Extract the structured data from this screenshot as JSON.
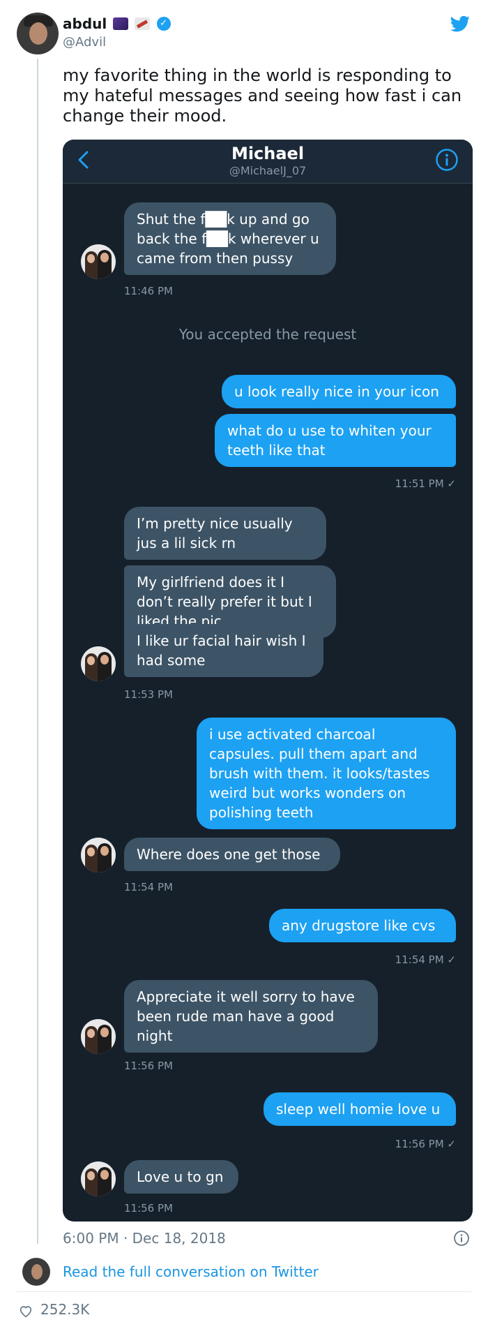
{
  "tweet": {
    "author_name": "abdul",
    "author_handle": "@Advil",
    "text": "my favorite thing in the world is responding to my hateful messages and seeing how fast i can change their mood.",
    "timestamp": "6:00 PM · Dec 18, 2018",
    "read_more": "Read the full conversation on Twitter",
    "likes": "252.3K"
  },
  "dm": {
    "contact_name": "Michael",
    "contact_handle": "@MichaelJ_07",
    "system_message": "You accepted the request",
    "messages": [
      {
        "dir": "in",
        "text": "Shut the f██k up and go back the f██k wherever u came from then pussy"
      },
      {
        "dir": "in",
        "time": "11:46 PM"
      },
      {
        "dir": "out",
        "text": "u look really nice in your icon"
      },
      {
        "dir": "out",
        "text": "what do u use to whiten your teeth like that"
      },
      {
        "dir": "out",
        "time": "11:51 PM ✓"
      },
      {
        "dir": "in",
        "text": "I’m pretty nice usually jus a lil sick rn"
      },
      {
        "dir": "in",
        "text": "My girlfriend does it I don’t really prefer it but I liked the pic"
      },
      {
        "dir": "in",
        "text": "I like ur facial hair wish I had some"
      },
      {
        "dir": "in",
        "time": "11:53 PM"
      },
      {
        "dir": "out",
        "text": "i use activated charcoal capsules. pull them apart and brush with them. it looks/tastes weird but works wonders on polishing teeth"
      },
      {
        "dir": "in",
        "text": "Where does one get those"
      },
      {
        "dir": "in",
        "time": "11:54 PM"
      },
      {
        "dir": "out",
        "text": "any drugstore like cvs"
      },
      {
        "dir": "out",
        "time": "11:54 PM ✓"
      },
      {
        "dir": "in",
        "text": "Appreciate it well sorry to have been rude man have a good night"
      },
      {
        "dir": "in",
        "time": "11:56 PM"
      },
      {
        "dir": "out",
        "text": "sleep well homie love u"
      },
      {
        "dir": "out",
        "time": "11:56 PM ✓"
      },
      {
        "dir": "in",
        "text": "Love u to gn"
      },
      {
        "dir": "in",
        "time": "11:56 PM"
      }
    ]
  },
  "icons": {
    "twitter_logo": "twitter-bird-icon",
    "verified": "verified-badge-icon",
    "back": "chevron-left-icon",
    "info": "info-icon",
    "like": "heart-icon"
  },
  "colors": {
    "dm_background": "#15202b",
    "incoming_bubble": "#3d5466",
    "outgoing_bubble": "#1da1f2",
    "link": "#1b95e0"
  }
}
